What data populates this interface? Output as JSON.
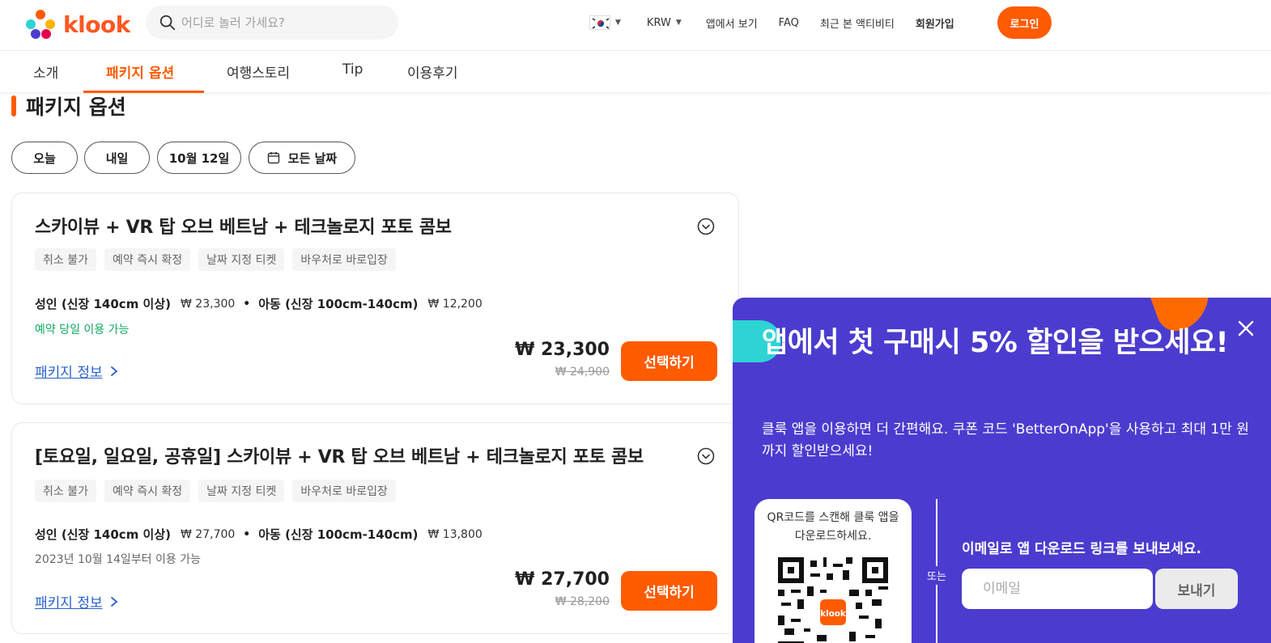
{
  "colors": {
    "brand": "#ff5b00",
    "promo_bg": "#4b3ccf",
    "link": "#2a62c9",
    "green": "#10a860"
  },
  "header": {
    "logo_text": "klook",
    "search_placeholder": "어디로 놀러 가세요?",
    "currency": "KRW",
    "links": [
      "앱에서 보기",
      "FAQ",
      "최근 본 액티비티",
      "회원가입"
    ],
    "login_label": "로그인"
  },
  "tabs": [
    {
      "label": "소개"
    },
    {
      "label": "패키지 옵션"
    },
    {
      "label": "여행스토리"
    },
    {
      "label": "Tip"
    },
    {
      "label": "이용후기"
    }
  ],
  "section_title": "패키지 옵션",
  "date_chips": [
    "오늘",
    "내일",
    "10월 12일",
    "모든 날짜"
  ],
  "packages": [
    {
      "title": "스카이뷰 + VR 탑 오브 베트남 + 테크놀로지 포토 콤보",
      "tags": [
        "취소 불가",
        "예약 즉시 확정",
        "날짜 지정 티켓",
        "바우처로 바로입장"
      ],
      "adult_label": "성인 (신장 140cm 이상)",
      "adult_price": "₩ 23,300",
      "child_label": "아동 (신장 100cm-140cm)",
      "child_price": "₩ 12,200",
      "availability": "예약 당일 이용 가능",
      "link": "패키지 정보",
      "price": "₩ 23,300",
      "original_price": "₩ 24,900",
      "select": "선택하기"
    },
    {
      "title": "[토요일, 일요일, 공휴일] 스카이뷰 + VR 탑 오브 베트남 + 테크놀로지 포토 콤보",
      "tags": [
        "취소 불가",
        "예약 즉시 확정",
        "날짜 지정 티켓",
        "바우처로 바로입장"
      ],
      "adult_label": "성인 (신장 140cm 이상)",
      "adult_price": "₩ 27,700",
      "child_label": "아동 (신장 100cm-140cm)",
      "child_price": "₩ 13,800",
      "availability": "2023년 10월 14일부터 이용 가능",
      "link": "패키지 정보",
      "price": "₩ 27,700",
      "original_price": "₩ 28,200",
      "select": "선택하기"
    }
  ],
  "promo": {
    "title": "앱에서 첫 구매시 5% 할인을 받으세요!",
    "description": "클룩 앱을 이용하면 더 간편해요. 쿠폰 코드 'BetterOnApp'을 사용하고 최대 1만 원까지 할인받으세요!",
    "qr_text": "QR코드를 스캔해 클룩 앱을 다운로드하세요.",
    "qr_badge": "klook",
    "or": "또는",
    "email_label": "이메일로 앱 다운로드 링크를 보내보세요.",
    "email_placeholder": "이메일",
    "send_label": "보내기"
  }
}
